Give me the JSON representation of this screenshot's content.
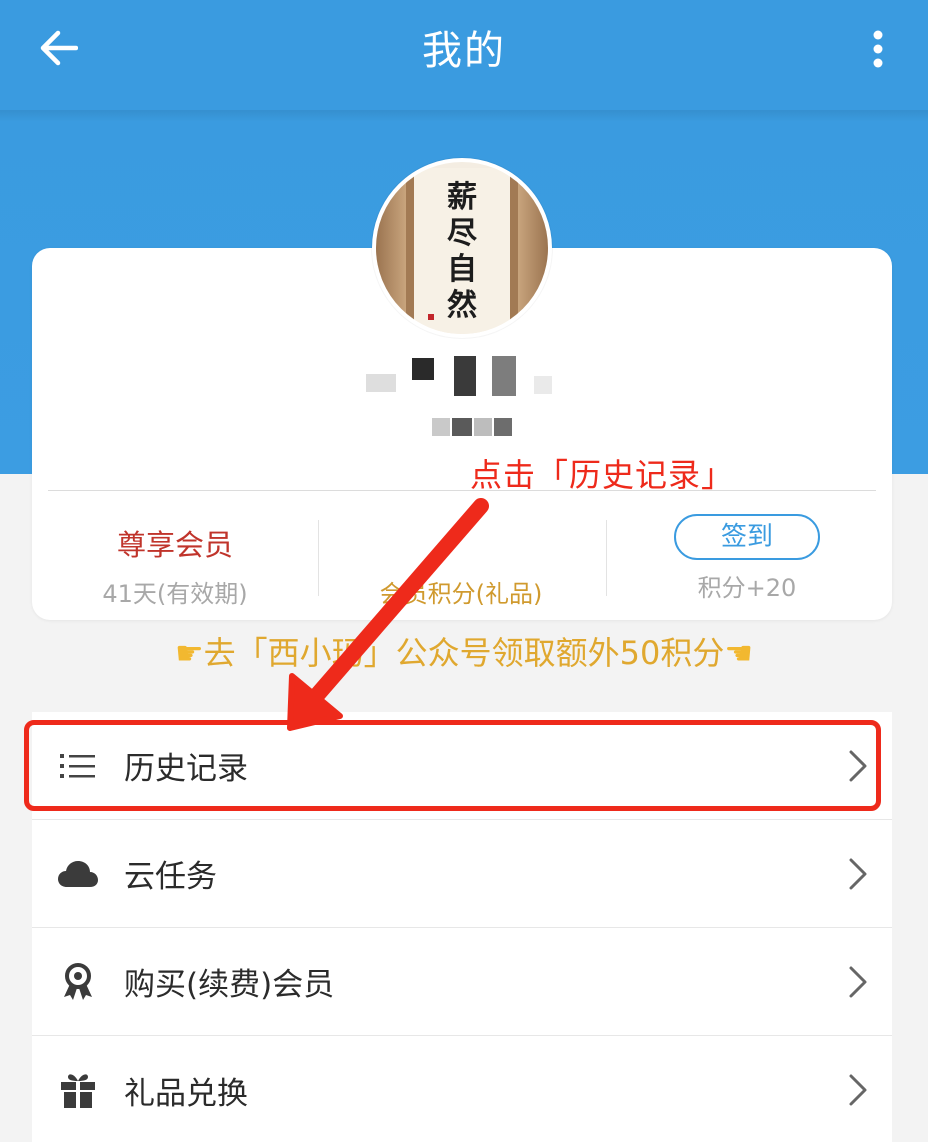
{
  "appbar": {
    "title": "我的",
    "back_icon": "arrow-left-icon",
    "more_icon": "more-vertical-icon"
  },
  "profile": {
    "avatar_calligraphy": "薪尽自然凉"
  },
  "stats": [
    {
      "main": "尊享会员",
      "sub": "41天(有效期)"
    },
    {
      "main": "",
      "sub": "会员积分(礼品)"
    },
    {
      "main": "签到",
      "sub": "积分+20"
    }
  ],
  "promo": {
    "text": "去「西小玛」公众号领取额外50积分"
  },
  "annotation": {
    "text": "点击「历史记录」"
  },
  "menu": [
    {
      "label": "历史记录",
      "icon": "list-icon"
    },
    {
      "label": "云任务",
      "icon": "cloud-icon"
    },
    {
      "label": "购买(续费)会员",
      "icon": "award-icon"
    },
    {
      "label": "礼品兑换",
      "icon": "gift-icon"
    }
  ],
  "colors": {
    "primary": "#3a9be0",
    "accent_red": "#ee2a1b",
    "member_red": "#c0342b",
    "promo_gold": "#e0a82f"
  }
}
